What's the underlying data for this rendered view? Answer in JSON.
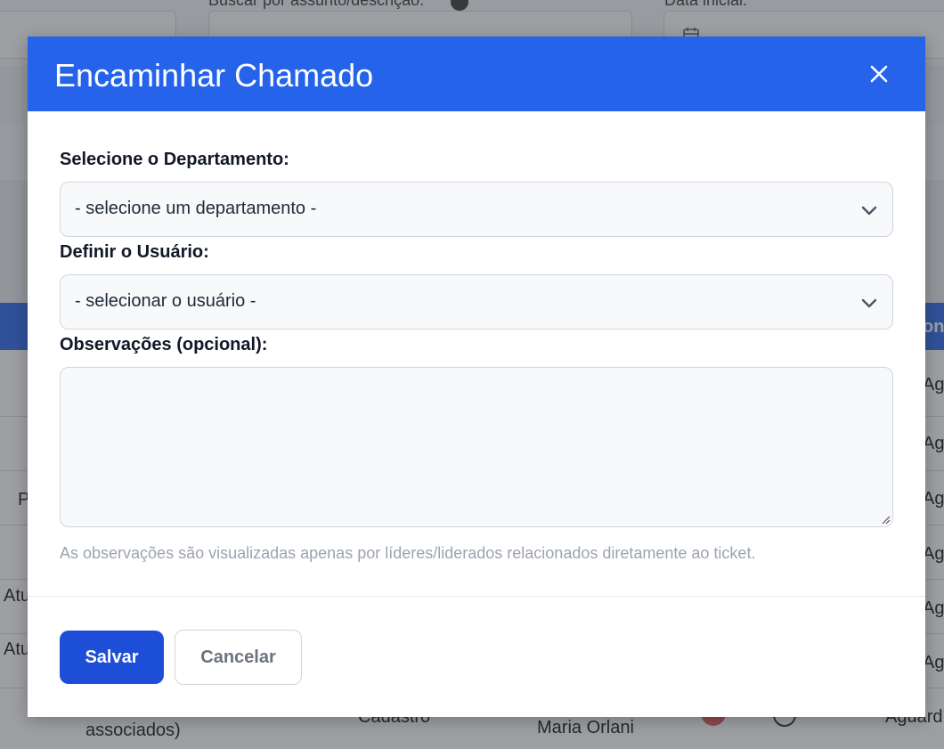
{
  "background": {
    "search_label": "Buscar por assunto/descrição:",
    "date_label": "Data inicial:",
    "table_header_partial": "on",
    "row_text_left_1": "P",
    "row_text_left_2": "Atu",
    "row_text_left_3": "Atu",
    "row_text_associados": "associados)",
    "row_text_cadastro": "Cadastro",
    "row_text_user": "Maria Orlani",
    "status_partial": "Aguard",
    "status_partial_last": "Aguard"
  },
  "modal": {
    "title": "Encaminhar Chamado",
    "department_label": "Selecione o Departamento:",
    "department_value": "- selecione um departamento -",
    "user_label": "Definir o Usuário:",
    "user_value": "- selecionar o usuário -",
    "notes_label": "Observações (opcional):",
    "notes_value": "",
    "notes_help": "As observações são visualizadas apenas por líderes/liderados relacionados diretamente ao ticket.",
    "save_label": "Salvar",
    "cancel_label": "Cancelar"
  },
  "colors": {
    "header": "#2563eb",
    "primary_button": "#1d4ed8"
  },
  "icons": {
    "close": "close-icon",
    "chevron": "chevron-down-icon",
    "calendar": "calendar-icon",
    "help": "help-icon"
  }
}
